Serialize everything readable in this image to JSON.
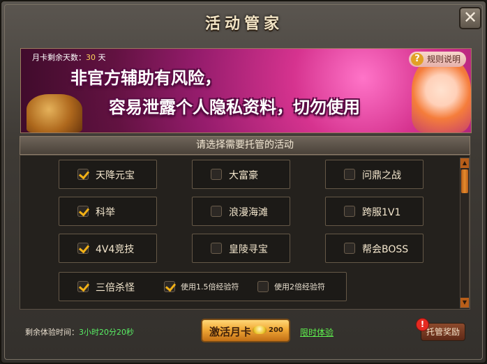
{
  "window": {
    "title": "活动管家",
    "close_glyph": "✕"
  },
  "banner": {
    "days_label": "月卡剩余天数：",
    "days_value": "30",
    "days_unit": "天",
    "help_label": "规则说明",
    "warning_line1": "非官方辅助有风险，",
    "warning_line2": "容易泄露个人隐私资料，切勿使用"
  },
  "section": {
    "header": "请选择需要托管的活动"
  },
  "activities": [
    {
      "label": "天降元宝",
      "checked": true
    },
    {
      "label": "大富豪",
      "checked": false
    },
    {
      "label": "问鼎之战",
      "checked": false
    },
    {
      "label": "科举",
      "checked": true
    },
    {
      "label": "浪漫海滩",
      "checked": false
    },
    {
      "label": "跨服1V1",
      "checked": false
    },
    {
      "label": "4V4竞技",
      "checked": true
    },
    {
      "label": "皇陵寻宝",
      "checked": false
    },
    {
      "label": "帮会BOSS",
      "checked": false
    }
  ],
  "triple": {
    "label": "三倍杀怪",
    "checked": true,
    "opt_15": {
      "label": "使用1.5倍经验符",
      "checked": true
    },
    "opt_2": {
      "label": "使用2倍经验符",
      "checked": false
    }
  },
  "footer": {
    "remain_label": "剩余体验时间：",
    "remain_value": "3小时20分20秒",
    "activate_label": "激活月卡",
    "activate_price": "200",
    "trial_link": "限时体验",
    "reward_label": "托管奖励",
    "reward_badge": "!"
  },
  "colors": {
    "accent": "#f2b116",
    "green_text": "#59f065",
    "banner_pink": "#d6338f"
  },
  "icons": {
    "close": "close-icon",
    "help": "question-icon",
    "ingot": "gold-ingot-icon",
    "alert": "exclamation-icon"
  }
}
